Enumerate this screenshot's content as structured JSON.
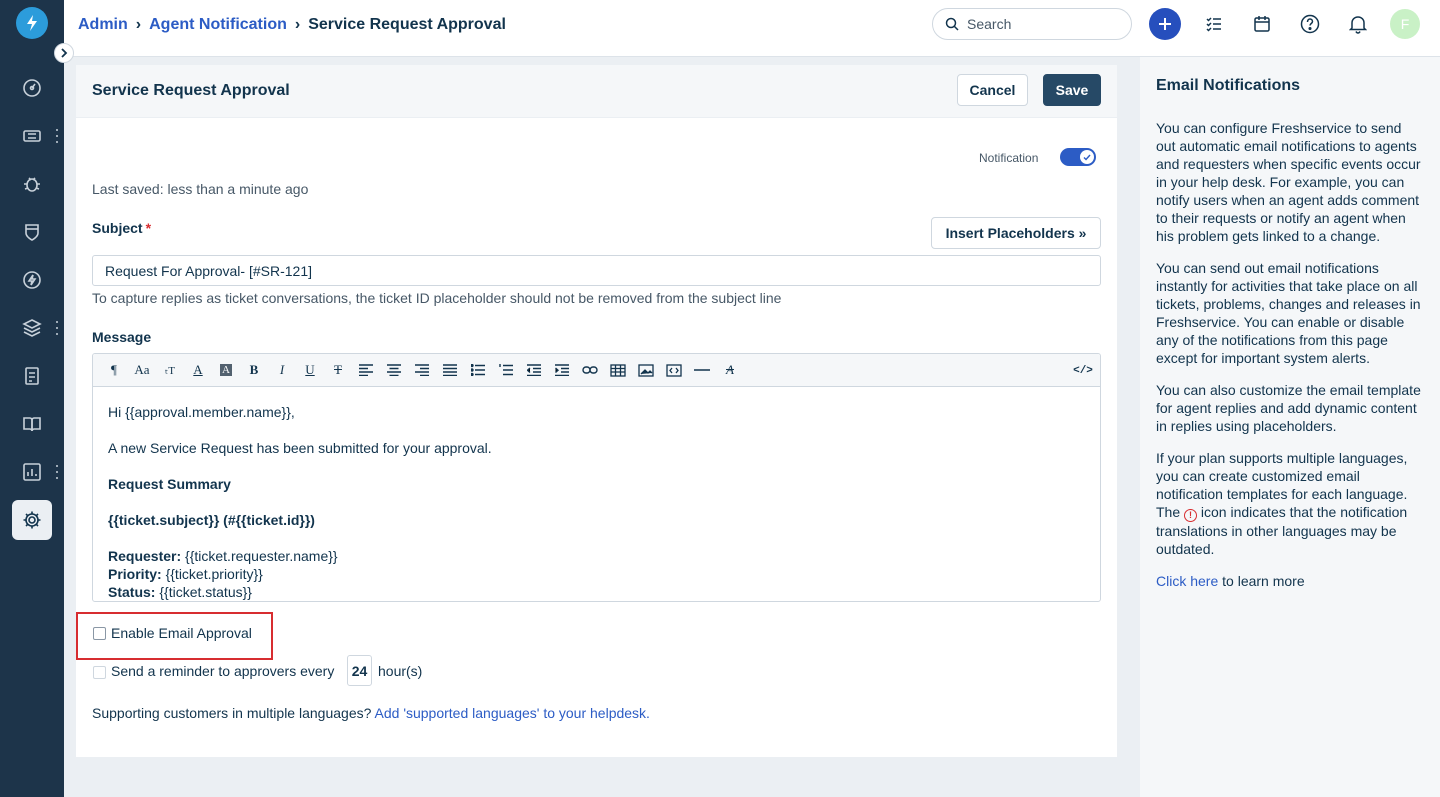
{
  "breadcrumb": {
    "admin": "Admin",
    "agent_notification": "Agent Notification",
    "current": "Service Request Approval"
  },
  "search": {
    "placeholder": "Search"
  },
  "user": {
    "avatar_initial": "F",
    "avatar_color": "#c9f1c6"
  },
  "page": {
    "title": "Service Request Approval",
    "cancel_label": "Cancel",
    "save_label": "Save",
    "notification_label": "Notification",
    "notification_enabled": true,
    "last_saved": "Last saved: less than a minute ago"
  },
  "subject": {
    "label": "Subject",
    "required_marker": "*",
    "insert_placeholders_label": "Insert Placeholders »",
    "value": "Request For Approval- [#SR-121]",
    "hint": "To capture replies as ticket conversations, the ticket ID placeholder should not be removed from the subject line"
  },
  "message": {
    "label": "Message",
    "greeting": "Hi {{approval.member.name}},",
    "intro": "A new Service Request has been submitted for your approval.",
    "summary_heading": "Request Summary",
    "ticket_line": "{{ticket.subject}} (#{{ticket.id}})",
    "requester_label": "Requester:",
    "requester_value": " {{ticket.requester.name}}",
    "priority_label": "Priority:",
    "priority_value": " {{ticket.priority}}",
    "status_label": "Status:",
    "status_value": " {{ticket.status}}"
  },
  "toolbar": {
    "items": [
      "paragraph-format",
      "font-family",
      "font-size",
      "text-color",
      "background-color",
      "bold",
      "italic",
      "underline",
      "strikethrough",
      "align-left",
      "align-center",
      "align-right",
      "align-justify",
      "unordered-list",
      "ordered-list",
      "outdent",
      "indent",
      "insert-link",
      "insert-table",
      "insert-image",
      "insert-code",
      "horizontal-line",
      "clear-formatting"
    ],
    "code_view_label": "</>"
  },
  "options": {
    "enable_email_approval_label": "Enable Email Approval",
    "enable_email_approval_checked": false,
    "reminder_prefix": "Send a reminder to approvers every",
    "reminder_hours": "24",
    "reminder_suffix": "hour(s)",
    "reminder_checked": false
  },
  "languages": {
    "text": "Supporting customers in multiple languages?",
    "link": "Add 'supported languages' to your helpdesk."
  },
  "help_panel": {
    "title": "Email Notifications",
    "p1": "You can configure Freshservice to send out automatic email notifications to agents and requesters when specific events occur in your help desk. For example, you can notify users when an agent adds comment to their requests or notify an agent when his problem gets linked to a change.",
    "p2": "You can send out email notifications instantly for activities that take place on all tickets, problems, changes and releases in Freshservice. You can enable or disable any of the notifications from this page except for important system alerts.",
    "p3": "You can also customize the email template for agent replies and add dynamic content in replies using placeholders.",
    "p4_before": "If your plan supports multiple languages, you can create customized email notification templates for each language. The ",
    "p4_after": " icon indicates that the notification translations in other languages may be outdated.",
    "warning_icon": "!",
    "learn_link": "Click here",
    "learn_suffix": " to learn more"
  },
  "colors": {
    "sidebar": "#1d344a",
    "brand_blue": "#2c5cc5",
    "primary_button": "#264966",
    "highlight_border": "#d72d30"
  }
}
